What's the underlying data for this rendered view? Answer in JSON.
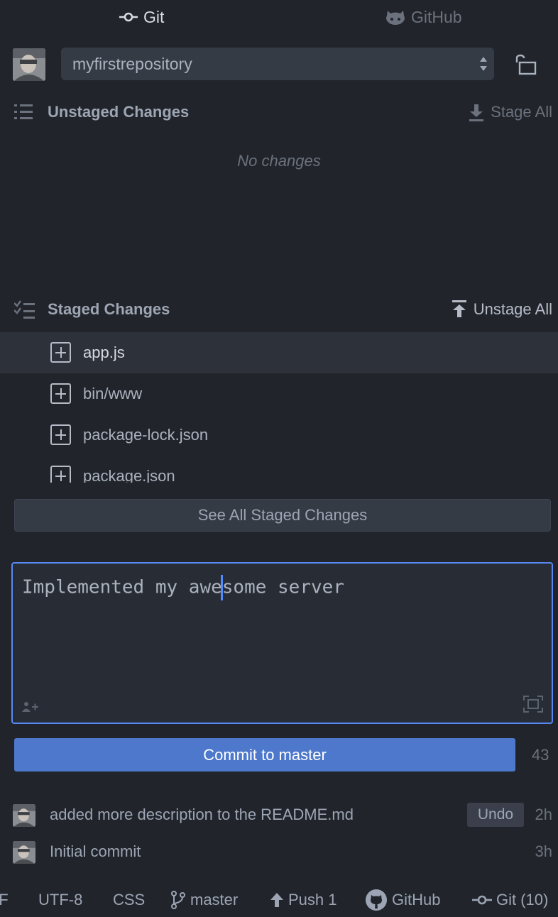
{
  "tabs": {
    "git": "Git",
    "github": "GitHub"
  },
  "repo": {
    "selected": "myfirstrepository"
  },
  "unstaged": {
    "title": "Unstaged Changes",
    "action": "Stage All",
    "empty_message": "No changes"
  },
  "staged": {
    "title": "Staged Changes",
    "action": "Unstage All",
    "files": [
      {
        "name": "app.js",
        "status": "added"
      },
      {
        "name": "bin/www",
        "status": "added"
      },
      {
        "name": "package-lock.json",
        "status": "added"
      },
      {
        "name": "package.json",
        "status": "added"
      }
    ],
    "see_all_label": "See All Staged Changes"
  },
  "commit_editor": {
    "text_before_caret": "Implemented my awe",
    "text_after_caret": "some server",
    "commit_button": "Commit to master",
    "remaining_chars": "43"
  },
  "recent_commits": [
    {
      "message": "added more description to the README.md",
      "time": "2h",
      "undo_label": "Undo"
    },
    {
      "message": "Initial commit",
      "time": "3h"
    }
  ],
  "status_bar": {
    "line_ending": "LF",
    "encoding": "UTF-8",
    "grammar": "CSS",
    "branch": "master",
    "push": "Push 1",
    "github": "GitHub",
    "git": "Git (10)"
  },
  "colors": {
    "background": "#21252b",
    "accent": "#568af2",
    "commit_button": "#4d78cc"
  }
}
